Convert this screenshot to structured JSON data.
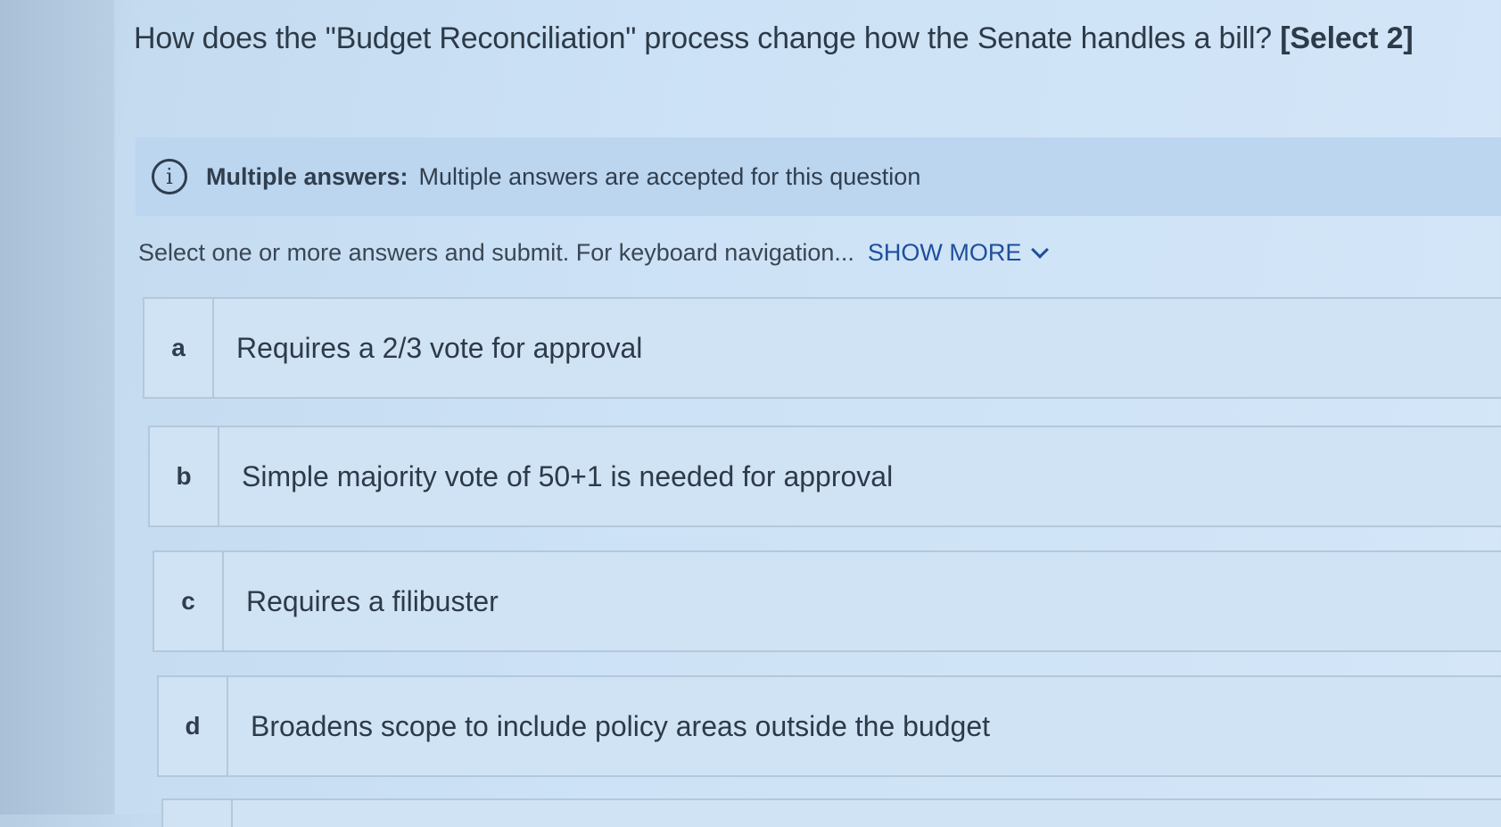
{
  "question": {
    "text": "How does the \"Budget Reconciliation\" process change how the Senate handles a bill?",
    "select_count": "[Select 2]"
  },
  "banner": {
    "icon": "info-circle-icon",
    "title": "Multiple answers:",
    "text": "Multiple answers are accepted for this question"
  },
  "instructions": {
    "text": "Select one or more answers and submit. For keyboard navigation...",
    "show_more_label": "SHOW MORE",
    "show_more_icon": "chevron-down-icon"
  },
  "options": [
    {
      "letter": "a",
      "text": "Requires a 2/3 vote for approval"
    },
    {
      "letter": "b",
      "text": "Simple majority vote of 50+1 is needed for approval"
    },
    {
      "letter": "c",
      "text": "Requires a filibuster"
    },
    {
      "letter": "d",
      "text": "Broadens scope to include policy areas outside the budget"
    }
  ],
  "colors": {
    "link": "#1d4f9c",
    "banner_bg": "#bcd6f0",
    "option_border": "#b4c8dc"
  }
}
